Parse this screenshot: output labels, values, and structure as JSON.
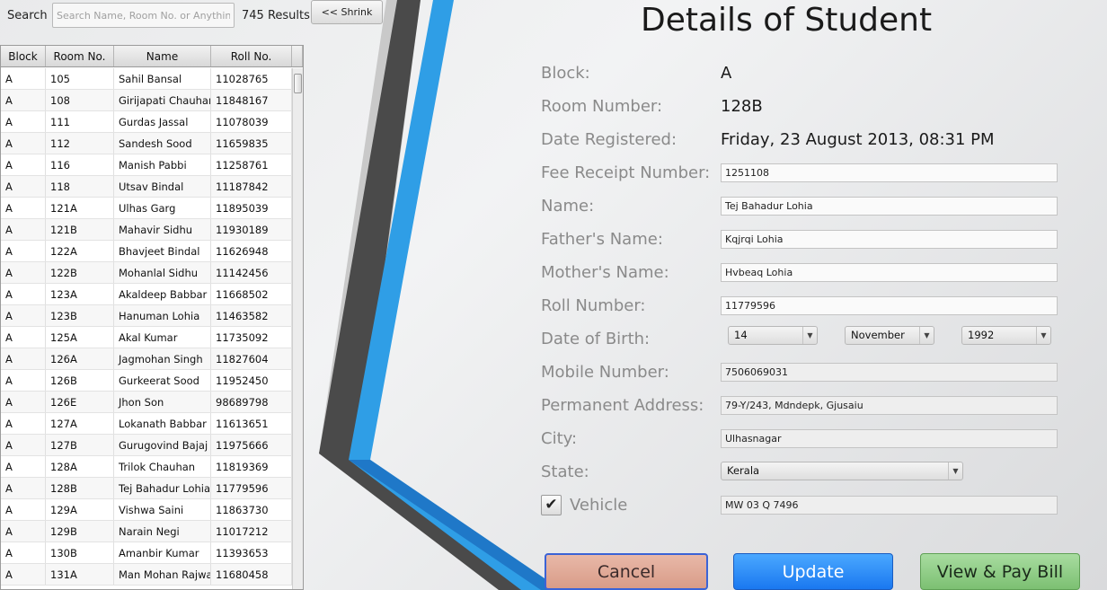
{
  "search": {
    "label": "Search",
    "placeholder": "Search Name, Room No. or Anything",
    "results": "745 Results",
    "shrink_label": "<< Shrink"
  },
  "table": {
    "headers": [
      "Block",
      "Room No.",
      "Name",
      "Roll No."
    ],
    "rows": [
      [
        "A",
        "105",
        "Sahil Bansal",
        "11028765"
      ],
      [
        "A",
        "108",
        "Girijapati Chauhan",
        "11848167"
      ],
      [
        "A",
        "111",
        "Gurdas Jassal",
        "11078039"
      ],
      [
        "A",
        "112",
        "Sandesh Sood",
        "11659835"
      ],
      [
        "A",
        "116",
        "Manish Pabbi",
        "11258761"
      ],
      [
        "A",
        "118",
        "Utsav Bindal",
        "11187842"
      ],
      [
        "A",
        "121A",
        "Ulhas Garg",
        "11895039"
      ],
      [
        "A",
        "121B",
        "Mahavir Sidhu",
        "11930189"
      ],
      [
        "A",
        "122A",
        "Bhavjeet Bindal",
        "11626948"
      ],
      [
        "A",
        "122B",
        "Mohanlal Sidhu",
        "11142456"
      ],
      [
        "A",
        "123A",
        "Akaldeep Babbar",
        "11668502"
      ],
      [
        "A",
        "123B",
        "Hanuman Lohia",
        "11463582"
      ],
      [
        "A",
        "125A",
        "Akal Kumar",
        "11735092"
      ],
      [
        "A",
        "126A",
        "Jagmohan Singh",
        "11827604"
      ],
      [
        "A",
        "126B",
        "Gurkeerat Sood",
        "11952450"
      ],
      [
        "A",
        "126E",
        "Jhon Son",
        "98689798"
      ],
      [
        "A",
        "127A",
        "Lokanath Babbar",
        "11613651"
      ],
      [
        "A",
        "127B",
        "Gurugovind Bajaj",
        "11975666"
      ],
      [
        "A",
        "128A",
        "Trilok Chauhan",
        "11819369"
      ],
      [
        "A",
        "128B",
        "Tej Bahadur Lohia",
        "11779596"
      ],
      [
        "A",
        "129A",
        "Vishwa Saini",
        "11863730"
      ],
      [
        "A",
        "129B",
        "Narain Negi",
        "11017212"
      ],
      [
        "A",
        "130B",
        "Amanbir Kumar",
        "11393653"
      ],
      [
        "A",
        "131A",
        "Man Mohan Rajwal",
        "11680458"
      ]
    ]
  },
  "details": {
    "title": "Details of Student",
    "labels": {
      "block": "Block:",
      "room": "Room Number:",
      "date_registered": "Date Registered:",
      "fee_receipt": "Fee Receipt Number:",
      "name": "Name:",
      "father": "Father's Name:",
      "mother": "Mother's Name:",
      "roll": "Roll Number:",
      "dob": "Date of Birth:",
      "mobile": "Mobile Number:",
      "address": "Permanent Address:",
      "city": "City:",
      "state": "State:",
      "vehicle": "Vehicle"
    },
    "values": {
      "block": "A",
      "room": "128B",
      "date_registered": "Friday, 23 August 2013, 08:31 PM",
      "fee_receipt": "1251108",
      "name": "Tej Bahadur Lohia",
      "father": "Kqjrqi Lohia",
      "mother": "Hvbeaq Lohia",
      "roll": "11779596",
      "dob_day": "14",
      "dob_month": "November",
      "dob_year": "1992",
      "mobile": "7506069031",
      "address": "79-Y/243, Mdndepk, Gjusaiu",
      "city": "Ulhasnagar",
      "state": "Kerala",
      "vehicle": "MW 03 Q 7496",
      "vehicle_checked": "✔"
    }
  },
  "buttons": {
    "cancel": "Cancel",
    "update": "Update",
    "view_pay": "View & Pay Bill"
  },
  "colors": {
    "stripe_dark": "#4a4a4a",
    "stripe_blue": "#2f9ee6",
    "update_blue": "#1a78f0"
  }
}
